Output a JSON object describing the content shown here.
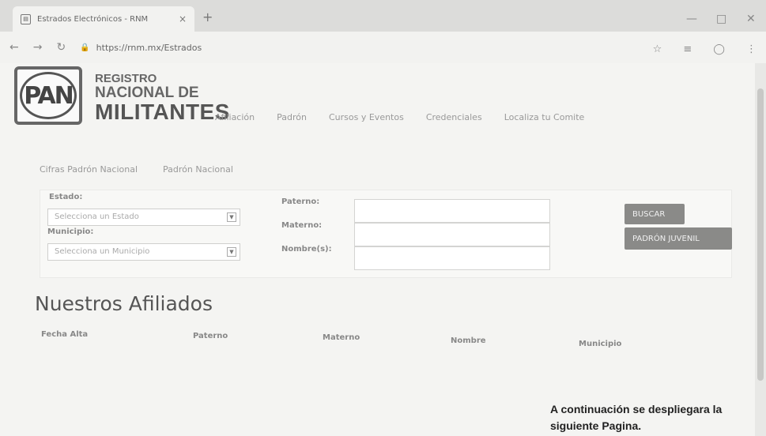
{
  "browser": {
    "tab_title": "Estrados Electrónicos - RNM",
    "tab_close": "×",
    "new_tab": "+",
    "url": "https://rnm.mx/Estrados",
    "favicon_icon": "page-icon"
  },
  "brand": {
    "logo_text": "PAN",
    "line1": "REGISTRO",
    "line2": "NACIONAL DE",
    "line3": "MILITANTES"
  },
  "nav": [
    "Afiliación",
    "Padrón",
    "Cursos y Eventos",
    "Credenciales",
    "Localiza tu Comite"
  ],
  "subtabs": [
    "Cifras Padrón Nacional",
    "Padrón Nacional"
  ],
  "search": {
    "estado_label": "Estado:",
    "estado_value": "Selecciona un Estado",
    "municipio_label": "Municipio:",
    "municipio_value": "Selecciona un Municipio",
    "paterno_label": "Paterno:",
    "materno_label": "Materno:",
    "nombre_label": "Nombre(s):",
    "buscar": "BUSCAR",
    "padron_juvenil": "PADRÓN JUVENIL"
  },
  "afiliados": {
    "title": "Nuestros Afiliados",
    "columns": [
      "Fecha Alta",
      "Paterno",
      "Materno",
      "Nombre",
      "Municipio"
    ]
  },
  "footnote": {
    "line1": "A continuación se despliegara la",
    "line2": "siguiente Pagina."
  },
  "colors": {
    "button": "#8a8a88",
    "background": "#f4f4f2"
  }
}
